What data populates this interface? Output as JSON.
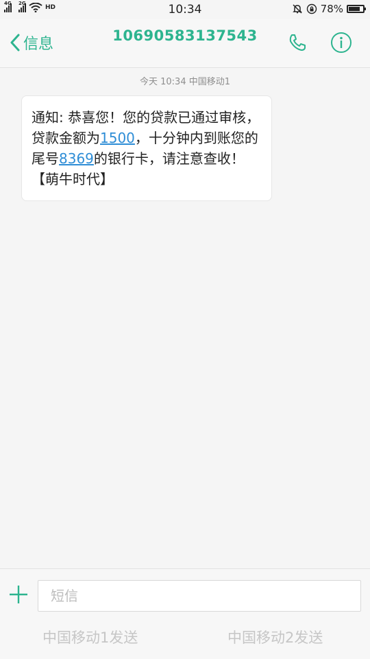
{
  "status_bar": {
    "sim1_network": "4G",
    "sim2_network": "2G",
    "hd_label": "HD",
    "time": "10:34",
    "battery_level": "78%",
    "battery_fraction": 0.78,
    "icons": [
      "signal-icon",
      "wifi-icon",
      "mute-bell-icon",
      "rotation-lock-icon",
      "battery-icon"
    ]
  },
  "header": {
    "back_label": "信息",
    "title": "10690583137543",
    "accent_color": "#2db48f"
  },
  "conversation": {
    "timestamp": "今天 10:34  中国移动1",
    "message": {
      "part1": "通知: 恭喜您！您的贷款已通过审核，贷款金额为",
      "link1": "1500",
      "part2": "，十分钟内到账您的尾号",
      "link2": "8369",
      "part3": "的银行卡，请注意查收！【萌牛时代】"
    },
    "link_color": "#2e8dd6"
  },
  "composer": {
    "placeholder": "短信",
    "send_sim1_label": "中国移动1发送",
    "send_sim2_label": "中国移动2发送"
  }
}
